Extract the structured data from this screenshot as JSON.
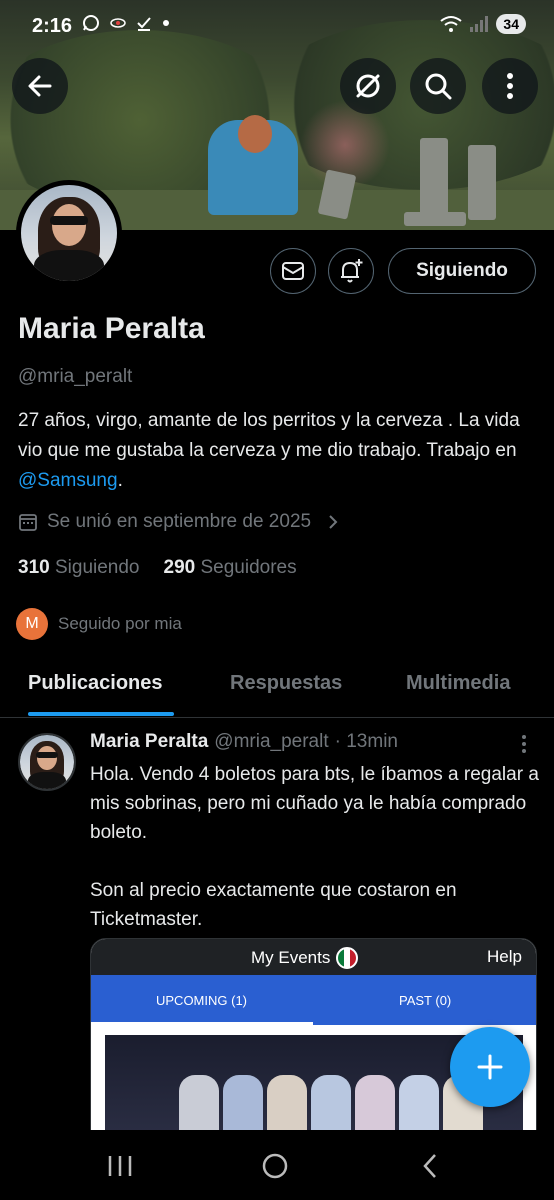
{
  "status_bar": {
    "time": "2:16",
    "battery": "34"
  },
  "header": {
    "back_icon": "arrow-left-icon",
    "grok_icon": "slashed-circle-icon",
    "search_icon": "search-icon",
    "more_icon": "more-vertical-icon"
  },
  "profile": {
    "name": "Maria Peralta",
    "handle": "@mria_peralt",
    "bio_text": "27 años, virgo, amante de los perritos y la cerveza . La vida vio que me gustaba la cerveza y me dio trabajo. Trabajo en ",
    "bio_mention": "@Samsung",
    "bio_end": ".",
    "joined": "Se unió en septiembre de 2025",
    "following_count": "310",
    "following_label": "Siguiendo",
    "followers_count": "290",
    "followers_label": "Seguidores",
    "followed_by_initial": "M",
    "followed_by": "Seguido por mia",
    "follow_button": "Siguiendo"
  },
  "tabs": [
    "Publicaciones",
    "Respuestas",
    "Multimedia"
  ],
  "tweet": {
    "author": "Maria Peralta",
    "handle": "@mria_peralt",
    "time": "· 13min",
    "text": "Hola. Vendo 4 boletos para bts, le íbamos a regalar a mis sobrinas, pero mi cuñado ya le había comprado boleto.\n\nSon al precio exactamente que costaron en Ticketmaster.",
    "embed": {
      "title": "My Events",
      "help": "Help",
      "tab_upcoming": "UPCOMING (1)",
      "tab_past": "PAST (0)"
    }
  },
  "colors": {
    "accent": "#1d9bf0",
    "muted": "#71767b",
    "text": "#e7e9ea",
    "background": "#000000"
  }
}
